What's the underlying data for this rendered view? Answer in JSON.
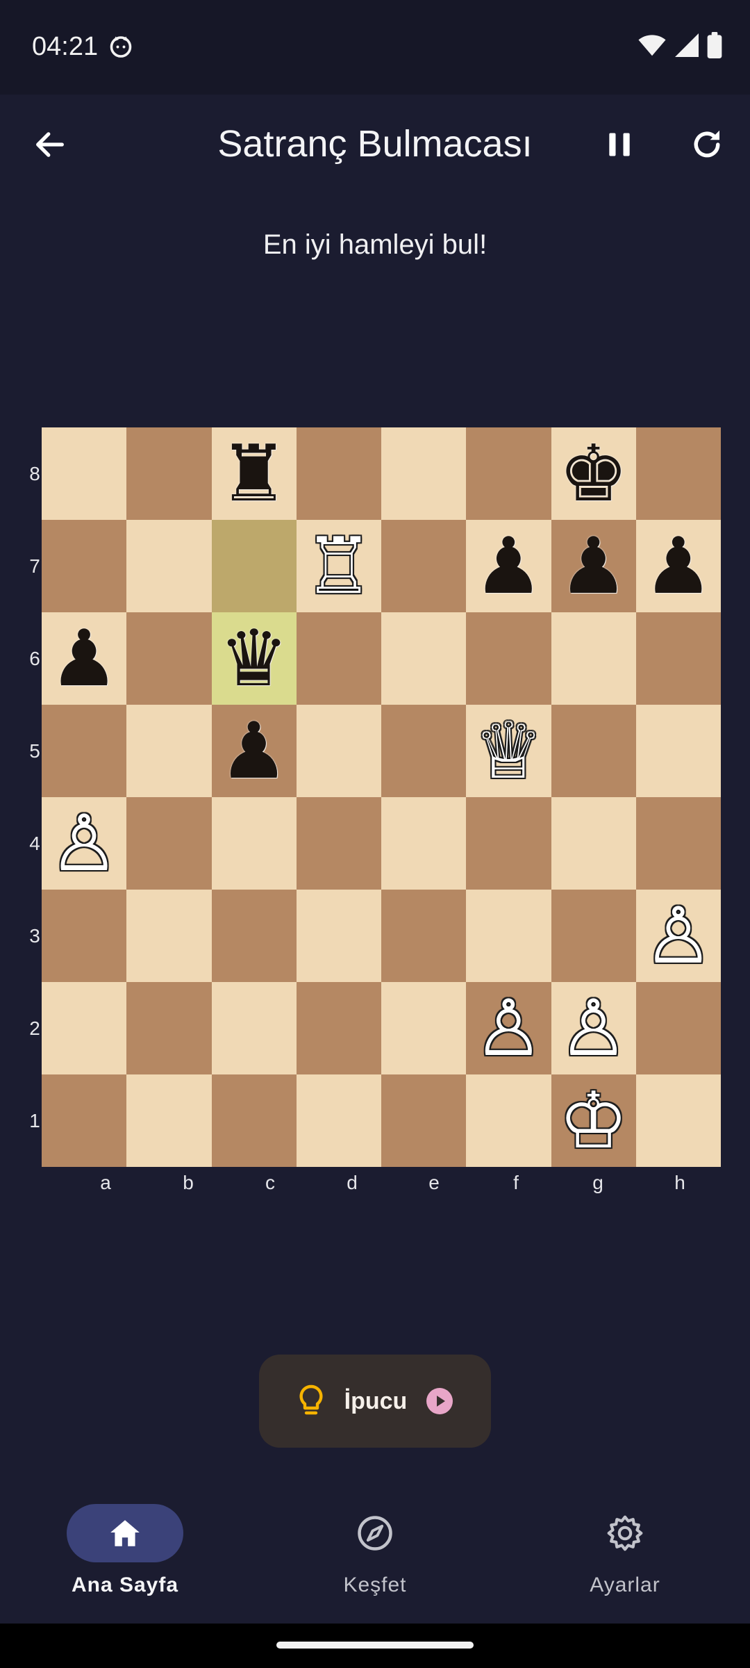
{
  "status_bar": {
    "time": "04:21"
  },
  "header": {
    "title": "Satranç Bulmacası",
    "back_icon": "arrow-left-icon",
    "pause_icon": "pause-icon",
    "refresh_icon": "refresh-icon"
  },
  "puzzle": {
    "prompt": "En iyi hamleyi bul!"
  },
  "board": {
    "ranks": [
      "8",
      "7",
      "6",
      "5",
      "4",
      "3",
      "2",
      "1"
    ],
    "files": [
      "a",
      "b",
      "c",
      "d",
      "e",
      "f",
      "g",
      "h"
    ],
    "highlight_squares": [
      "c7",
      "c6"
    ],
    "pieces": [
      {
        "square": "c8",
        "color": "b",
        "glyph": "♜"
      },
      {
        "square": "g8",
        "color": "b",
        "glyph": "♚"
      },
      {
        "square": "d7",
        "color": "w",
        "glyph": "♖"
      },
      {
        "square": "f7",
        "color": "b",
        "glyph": "♟"
      },
      {
        "square": "g7",
        "color": "b",
        "glyph": "♟"
      },
      {
        "square": "h7",
        "color": "b",
        "glyph": "♟"
      },
      {
        "square": "a6",
        "color": "b",
        "glyph": "♟"
      },
      {
        "square": "c6",
        "color": "b",
        "glyph": "♛"
      },
      {
        "square": "c5",
        "color": "b",
        "glyph": "♟"
      },
      {
        "square": "f5",
        "color": "w",
        "glyph": "♕"
      },
      {
        "square": "a4",
        "color": "w",
        "glyph": "♙"
      },
      {
        "square": "h3",
        "color": "w",
        "glyph": "♙"
      },
      {
        "square": "f2",
        "color": "w",
        "glyph": "♙"
      },
      {
        "square": "g2",
        "color": "w",
        "glyph": "♙"
      },
      {
        "square": "g1",
        "color": "w",
        "glyph": "♔"
      }
    ],
    "colors": {
      "light": "#f0d9b5",
      "dark": "#b58863",
      "highlight": "#dadb8e"
    }
  },
  "hint_button": {
    "label": "İpucu",
    "bulb_icon": "lightbulb-icon",
    "play_icon": "play-circle-icon"
  },
  "bottom_nav": {
    "items": [
      {
        "label": "Ana Sayfa",
        "icon": "home-icon",
        "active": true
      },
      {
        "label": "Keşfet",
        "icon": "compass-icon",
        "active": false
      },
      {
        "label": "Ayarlar",
        "icon": "gear-icon",
        "active": false
      }
    ]
  }
}
